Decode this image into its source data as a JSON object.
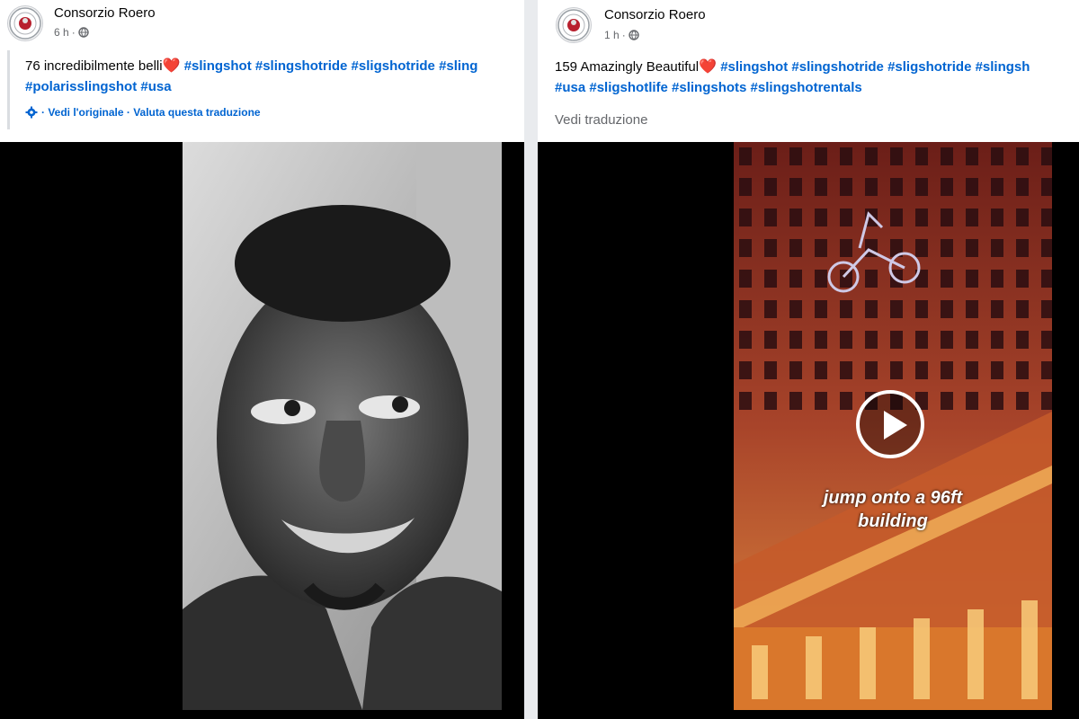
{
  "posts": [
    {
      "author": "Consorzio Roero",
      "time": "6 h",
      "caption": {
        "text": "76 incredibilmente belli",
        "heart": "❤️",
        "line1_tags": "#slingshot #slingshotride #sligshotride #sling",
        "line2_tags": "#polarisslingshot #usa"
      },
      "translation_links": "· Vedi l'originale · Valuta questa traduzione",
      "media": {
        "kind": "photo",
        "description_icon": "portrait-photo"
      }
    },
    {
      "author": "Consorzio Roero",
      "time": "1 h",
      "caption": {
        "text": "159 Amazingly Beautiful",
        "heart": "❤️",
        "line1_tags": "#slingshot #slingshotride #sligshotride #slingsh",
        "line2_tags": "#usa #sligshotlife #slingshots #slingshotrentals"
      },
      "see_translation": "Vedi traduzione",
      "media": {
        "kind": "video",
        "overlay_line1": "jump onto a 96ft",
        "overlay_line2": "building"
      }
    }
  ],
  "colors": {
    "link": "#0064d1",
    "secondary_text": "#65676b",
    "heart": "#e41e3f"
  }
}
